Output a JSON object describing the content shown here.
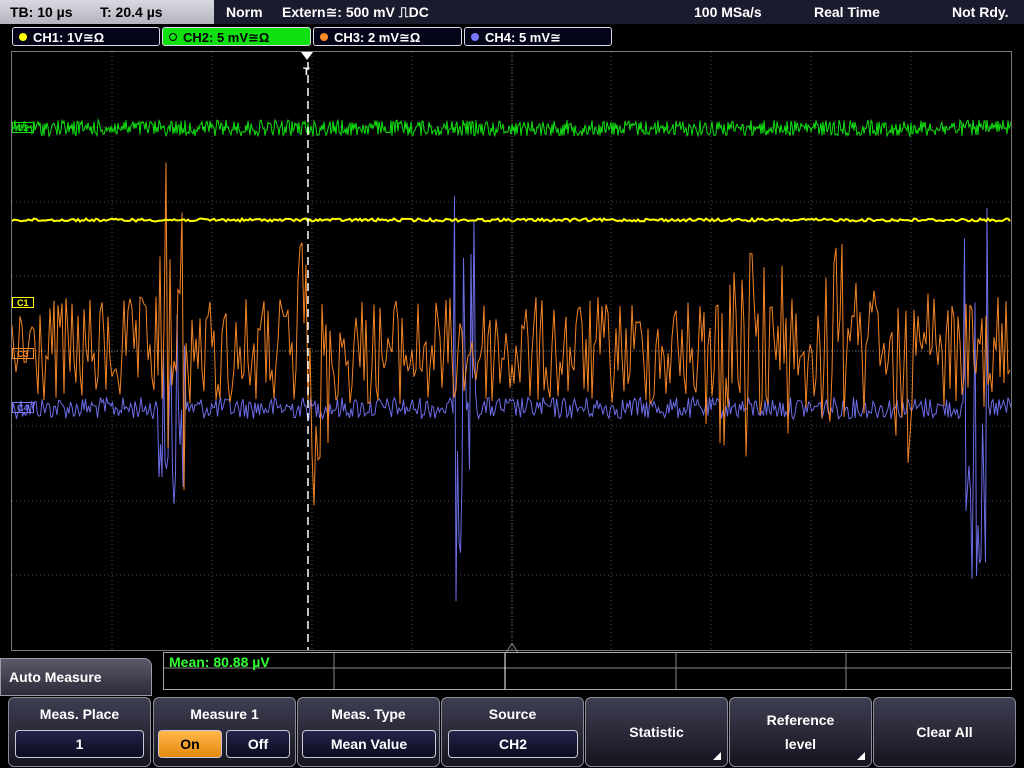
{
  "topbar": {
    "timebase": "TB: 10 µs",
    "trigger_time": "T: 20.4 µs",
    "mode": "Norm",
    "trigger_source": "Extern≅: 500 mV ⎍DC",
    "sample_rate": "100 MSa/s",
    "acquisition": "Real Time",
    "status": "Not Rdy."
  },
  "channels": [
    {
      "label": "CH1: 1V≅Ω",
      "color": "#ffff00",
      "active": false
    },
    {
      "label": "CH2: 5 mV≅Ω",
      "color": "#10e010",
      "active": true
    },
    {
      "label": "CH3: 2 mV≅Ω",
      "color": "#ff8c28",
      "active": false
    },
    {
      "label": "CH4: 5 mV≅",
      "color": "#7878ff",
      "active": false
    }
  ],
  "markers": {
    "c2": "C2",
    "c1": "C1",
    "c3": "C3",
    "c4": "C4",
    "trigger": "T"
  },
  "measurement": {
    "readout": "Mean: 80.88 µV"
  },
  "menu": {
    "title": "Auto Measure",
    "meas_place": {
      "title": "Meas. Place",
      "value": "1"
    },
    "measure1": {
      "title": "Measure 1",
      "on": "On",
      "off": "Off",
      "state": "on"
    },
    "meas_type": {
      "title": "Meas. Type",
      "value": "Mean Value"
    },
    "source": {
      "title": "Source",
      "value": "CH2"
    },
    "statistic": {
      "label": "Statistic"
    },
    "reference": {
      "line1": "Reference",
      "line2": "level"
    },
    "clear_all": {
      "label": "Clear All"
    }
  },
  "colors": {
    "ch1": "#ffff00",
    "ch2": "#10e010",
    "ch3": "#ff8c28",
    "ch4": "#7878ff",
    "measure_text": "#32ff32",
    "grid": "#4a4a4a"
  }
}
